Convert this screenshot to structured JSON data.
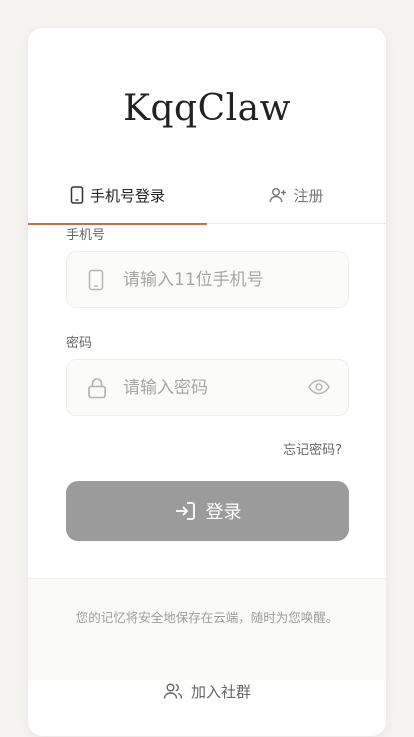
{
  "app": {
    "title": "KqqClaw"
  },
  "tabs": [
    {
      "label": "手机号登录",
      "icon": "phone-icon",
      "active": true
    },
    {
      "label": "注册",
      "icon": "user-plus-icon",
      "active": false
    }
  ],
  "form": {
    "phone": {
      "label": "手机号",
      "placeholder": "请输入11位手机号",
      "value": "",
      "icon": "phone-icon"
    },
    "password": {
      "label": "密码",
      "placeholder": "请输入密码",
      "value": "",
      "icon": "lock-icon",
      "toggle_icon": "eye-icon"
    },
    "forgot_label": "忘记密码?",
    "submit_label": "登录",
    "submit_icon": "login-arrow-icon"
  },
  "footer": {
    "text": "您的记忆将安全地保存在云端，随时为您唤醒。",
    "community_label": "加入社群",
    "community_icon": "users-icon"
  },
  "colors": {
    "accent": "#c0704a",
    "button_bg": "#9b9b9b",
    "page_bg": "#f4f3ef"
  }
}
